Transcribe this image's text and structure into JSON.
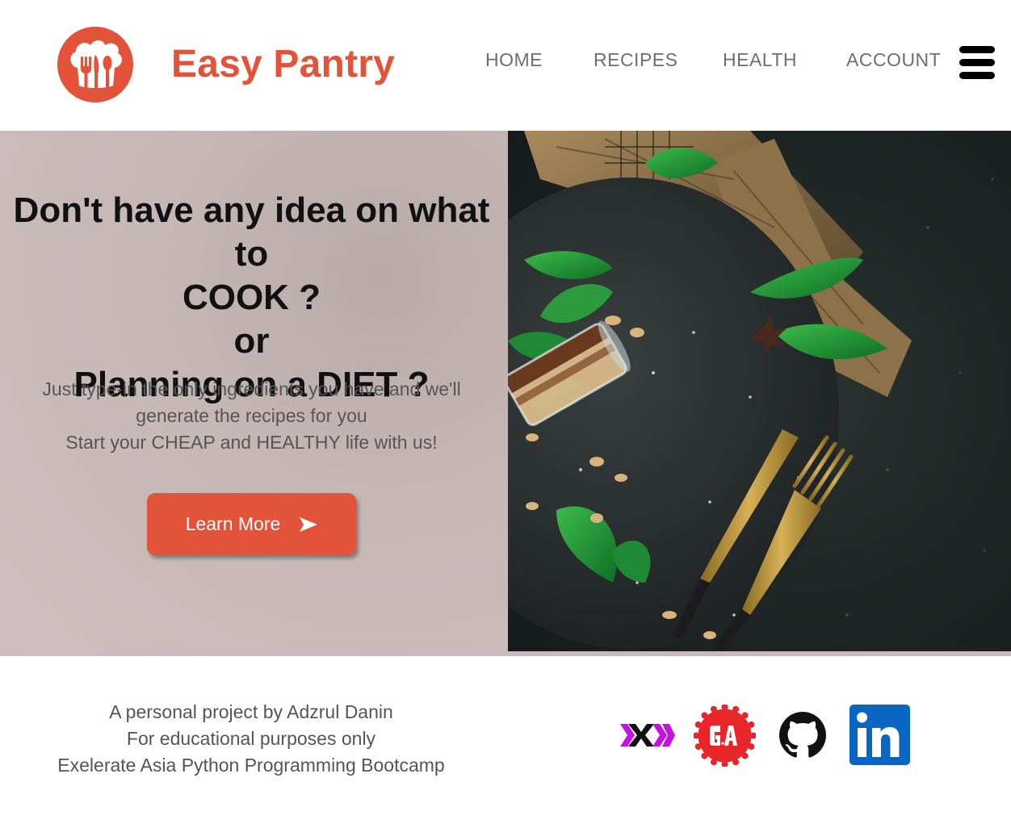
{
  "header": {
    "brand": "Easy Pantry",
    "logo_icon": "chef-hat-utensils-icon",
    "nav": [
      "HOME",
      "RECIPES",
      "HEALTH",
      "ACCOUNT"
    ],
    "menu_icon": "hamburger-menu-icon"
  },
  "hero": {
    "headline": {
      "line1": "Don't have any idea on what to",
      "line2": "COOK ?",
      "line3": "or",
      "line4": "Planning on a DIET ?"
    },
    "subtext": {
      "line1": "Just type-in the only ingredients you have and we'll",
      "line2": "generate the recipes for you",
      "line3": "Start your CHEAP and HEALTHY life with us!"
    },
    "cta_label": "Learn More",
    "cta_icon": "arrow-right-icon",
    "photo": "food-on-slate-board-photo"
  },
  "footer": {
    "line1": "A personal project by Adzrul Danin",
    "line2": "For educational purposes only",
    "line3": "Exelerate Asia Python Programming Bootcamp",
    "social": [
      "exelerate-icon",
      "general-assembly-icon",
      "github-icon",
      "linkedin-icon"
    ]
  },
  "colors": {
    "accent": "#e2533a",
    "hero_bg": "#cabbbb",
    "nav_text": "#6e6e6e",
    "body_text": "#555555",
    "linkedin": "#0a66c2",
    "exelerate": "#c313e0"
  }
}
